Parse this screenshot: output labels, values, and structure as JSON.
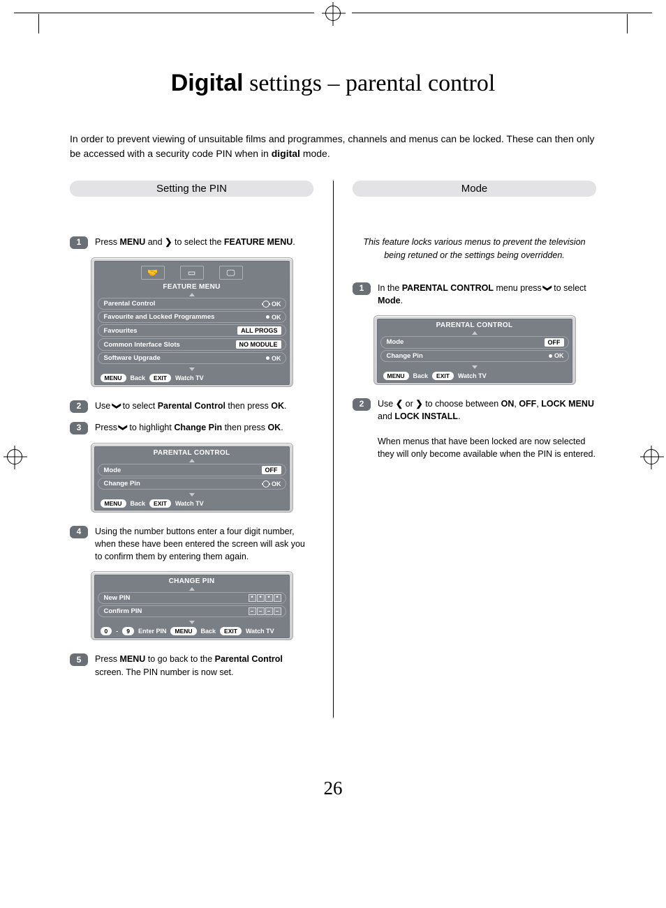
{
  "title_bold": "Digital",
  "title_rest": " settings – parental control",
  "intro_pre": "In order to prevent viewing of unsuitable films and programmes, channels and menus can be locked. These can then only be accessed with a security code PIN when in ",
  "intro_bold": "digital",
  "intro_post": " mode.",
  "page_number": "26",
  "left": {
    "header": "Setting the PIN",
    "steps": {
      "s1": {
        "num": "1",
        "pre": "Press ",
        "b1": "MENU",
        "mid": " and ",
        "chev": "❯",
        "post": " to select the ",
        "b2": "FEATURE MENU",
        "end": "."
      },
      "s2": {
        "num": "2",
        "pre": "Use ",
        "chev": "❯",
        "rot": " ",
        "mid": " to select ",
        "b1": "Parental Control",
        "post": " then press ",
        "b2": "OK",
        "end": "."
      },
      "s3": {
        "num": "3",
        "pre": "Press ",
        "chev": "❯",
        "mid": " to highlight ",
        "b1": "Change Pin",
        "post": " then press ",
        "b2": "OK",
        "end": "."
      },
      "s4": {
        "num": "4",
        "text": "Using the number buttons enter a four digit number, when these have been entered the screen will ask you to confirm them by entering them again."
      },
      "s5": {
        "num": "5",
        "pre": "Press ",
        "b1": "MENU",
        "mid": " to go back to the ",
        "b2": "Parental Control",
        "post": " screen. The PIN number is now set."
      }
    },
    "osd1": {
      "title": "FEATURE MENU",
      "rows": {
        "r1": {
          "label": "Parental Control",
          "ok": "OK"
        },
        "r2": {
          "label": "Favourite and Locked Programmes",
          "ok": "OK"
        },
        "r3": {
          "label": "Favourites",
          "chip": "ALL PROGS"
        },
        "r4": {
          "label": "Common Interface Slots",
          "chip": "NO MODULE"
        },
        "r5": {
          "label": "Software Upgrade",
          "ok": "OK"
        }
      },
      "footer": {
        "menu": "MENU",
        "back": "Back",
        "exit": "EXIT",
        "watch": "Watch TV"
      }
    },
    "osd2": {
      "title": "PARENTAL CONTROL",
      "rows": {
        "r1": {
          "label": "Mode",
          "chip": "OFF"
        },
        "r2": {
          "label": "Change Pin",
          "ok": "OK"
        }
      },
      "footer": {
        "menu": "MENU",
        "back": "Back",
        "exit": "EXIT",
        "watch": "Watch TV"
      }
    },
    "osd3": {
      "title": "CHANGE PIN",
      "rows": {
        "r1": {
          "label": "New PIN"
        },
        "r2": {
          "label": "Confirm PIN"
        }
      },
      "footer": {
        "zero": "0",
        "nine": "9",
        "enter": "Enter PIN",
        "menu": "MENU",
        "back": "Back",
        "exit": "EXIT",
        "watch": "Watch TV"
      }
    }
  },
  "right": {
    "header": "Mode",
    "note": "This feature locks various menus to prevent the television being retuned or the settings being overridden.",
    "steps": {
      "s1": {
        "num": "1",
        "pre": "In the ",
        "b1": "PARENTAL CONTROL",
        "mid": " menu press ",
        "chev": "❯",
        "post": " to select ",
        "b2": "Mode",
        "end": "."
      },
      "s2": {
        "num": "2",
        "pre": "Use ",
        "chevL": "❮",
        "or": " or ",
        "chevR": "❯",
        "mid": " to choose between ",
        "b1": "ON",
        "c1": ", ",
        "b2": "OFF",
        "c2": ", ",
        "b3": "LOCK MENU",
        "and": " and ",
        "b4": "LOCK INSTALL",
        "end": "."
      },
      "s2_extra": "When menus that have been locked are now selected they will only become available when the PIN is entered."
    },
    "osd": {
      "title": "PARENTAL CONTROL",
      "rows": {
        "r1": {
          "label": "Mode",
          "chip": "OFF"
        },
        "r2": {
          "label": "Change Pin",
          "ok": "OK"
        }
      },
      "footer": {
        "menu": "MENU",
        "back": "Back",
        "exit": "EXIT",
        "watch": "Watch TV"
      }
    }
  }
}
